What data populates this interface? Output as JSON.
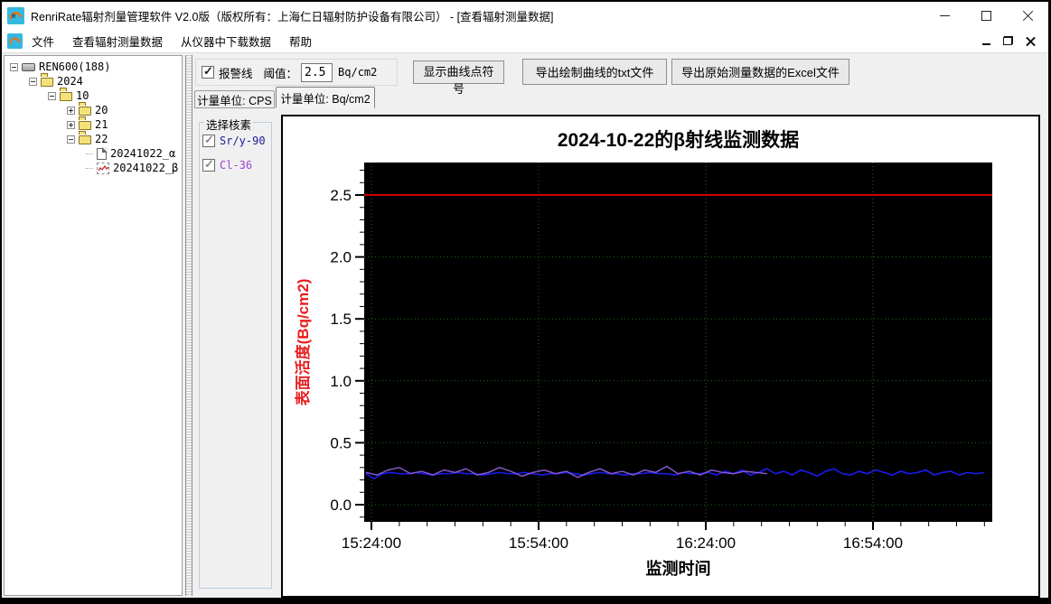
{
  "window": {
    "title": "RenriRate辐射剂量管理软件 V2.0版（版权所有：上海仁日辐射防护设备有限公司） - [查看辐射测量数据]"
  },
  "menu": {
    "items": [
      "文件",
      "查看辐射测量数据",
      "从仪器中下载数据",
      "帮助"
    ]
  },
  "tree": {
    "items": [
      {
        "label": "REN600(188)",
        "level": 0,
        "expander": "minus",
        "icon": "device-icon"
      },
      {
        "label": "2024",
        "level": 1,
        "expander": "minus",
        "icon": "folder-icon"
      },
      {
        "label": "10",
        "level": 2,
        "expander": "minus",
        "icon": "folder-icon"
      },
      {
        "label": "20",
        "level": 3,
        "expander": "plus",
        "icon": "folder-icon"
      },
      {
        "label": "21",
        "level": 3,
        "expander": "plus",
        "icon": "folder-icon"
      },
      {
        "label": "22",
        "level": 3,
        "expander": "minus",
        "icon": "folder-icon"
      },
      {
        "label": "20241022_α",
        "level": 4,
        "expander": "none",
        "icon": "document-icon"
      },
      {
        "label": "20241022_β",
        "level": 4,
        "expander": "none",
        "icon": "chart-file-icon"
      }
    ]
  },
  "toolbar": {
    "alarm_label": "报警线",
    "alarm_checked": true,
    "threshold_label": "阈值：",
    "threshold_value": "2.5",
    "threshold_unit": "Bq/cm2",
    "buttons": {
      "show_points": "显示曲线点符号",
      "export_txt": "导出绘制曲线的txt文件",
      "export_excel": "导出原始测量数据的Excel文件"
    }
  },
  "tabs": [
    {
      "label": "计量单位: CPS",
      "active": false
    },
    {
      "label": "计量单位: Bq/cm2",
      "active": true
    }
  ],
  "nuclides": {
    "title": "选择核素",
    "items": [
      {
        "label": "Sr/y-90",
        "checked": true,
        "color": "#1c1c96"
      },
      {
        "label": "Cl-36",
        "checked": true,
        "color": "#a041d2"
      }
    ]
  },
  "chart_data": {
    "type": "line",
    "title": "2024-10-22的β射线监测数据",
    "xlabel": "监测时间",
    "ylabel": "表面活度(Bq/cm2)",
    "ylabel_color": "#e81e1e",
    "plot_bg": "#000000",
    "grid_color": "#1e6e1e",
    "grid": true,
    "ylim": [
      -0.14,
      2.76
    ],
    "xlim_minutes": [
      -1.3,
      111.4
    ],
    "x_ticks": [
      {
        "min": 0,
        "label": "15:24:00"
      },
      {
        "min": 30,
        "label": "15:54:00"
      },
      {
        "min": 60,
        "label": "16:24:00"
      },
      {
        "min": 90,
        "label": "16:54:00"
      }
    ],
    "x_minor_step_min": 5,
    "y_ticks": [
      0.0,
      0.5,
      1.0,
      1.5,
      2.0,
      2.5
    ],
    "y_minor_step": 0.1,
    "alarm_line": {
      "value": 2.5,
      "color": "#c80000"
    },
    "series": [
      {
        "name": "Sr/y-90",
        "color": "#1a1ae6",
        "width": 1.7,
        "start_min": -1,
        "step_min": 1.5,
        "values": [
          0.25,
          0.21,
          0.25,
          0.26,
          0.25,
          0.25,
          0.26,
          0.25,
          0.24,
          0.25,
          0.25,
          0.26,
          0.25,
          0.25,
          0.24,
          0.25,
          0.26,
          0.25,
          0.25,
          0.26,
          0.25,
          0.24,
          0.25,
          0.25,
          0.26,
          0.25,
          0.24,
          0.25,
          0.26,
          0.25,
          0.25,
          0.24,
          0.25,
          0.25,
          0.26,
          0.25,
          0.25,
          0.24,
          0.26,
          0.25,
          0.25,
          0.26,
          0.24,
          0.27,
          0.25,
          0.28,
          0.24,
          0.26,
          0.29,
          0.25,
          0.27,
          0.24,
          0.28,
          0.26,
          0.23,
          0.27,
          0.29,
          0.25,
          0.24,
          0.27,
          0.25,
          0.28,
          0.26,
          0.24,
          0.27,
          0.25,
          0.26,
          0.28,
          0.24,
          0.26,
          0.27,
          0.24,
          0.26,
          0.25,
          0.26
        ]
      },
      {
        "name": "Cl-36",
        "color": "#8a5ad8",
        "width": 1.4,
        "start_min": -1,
        "step_min": 2,
        "values": [
          0.26,
          0.24,
          0.28,
          0.3,
          0.25,
          0.27,
          0.24,
          0.28,
          0.26,
          0.29,
          0.24,
          0.26,
          0.3,
          0.27,
          0.23,
          0.26,
          0.28,
          0.25,
          0.27,
          0.22,
          0.26,
          0.29,
          0.25,
          0.27,
          0.24,
          0.28,
          0.26,
          0.31,
          0.25,
          0.27,
          0.24,
          0.28,
          0.26,
          0.25,
          0.27,
          0.26,
          0.25
        ]
      }
    ]
  }
}
